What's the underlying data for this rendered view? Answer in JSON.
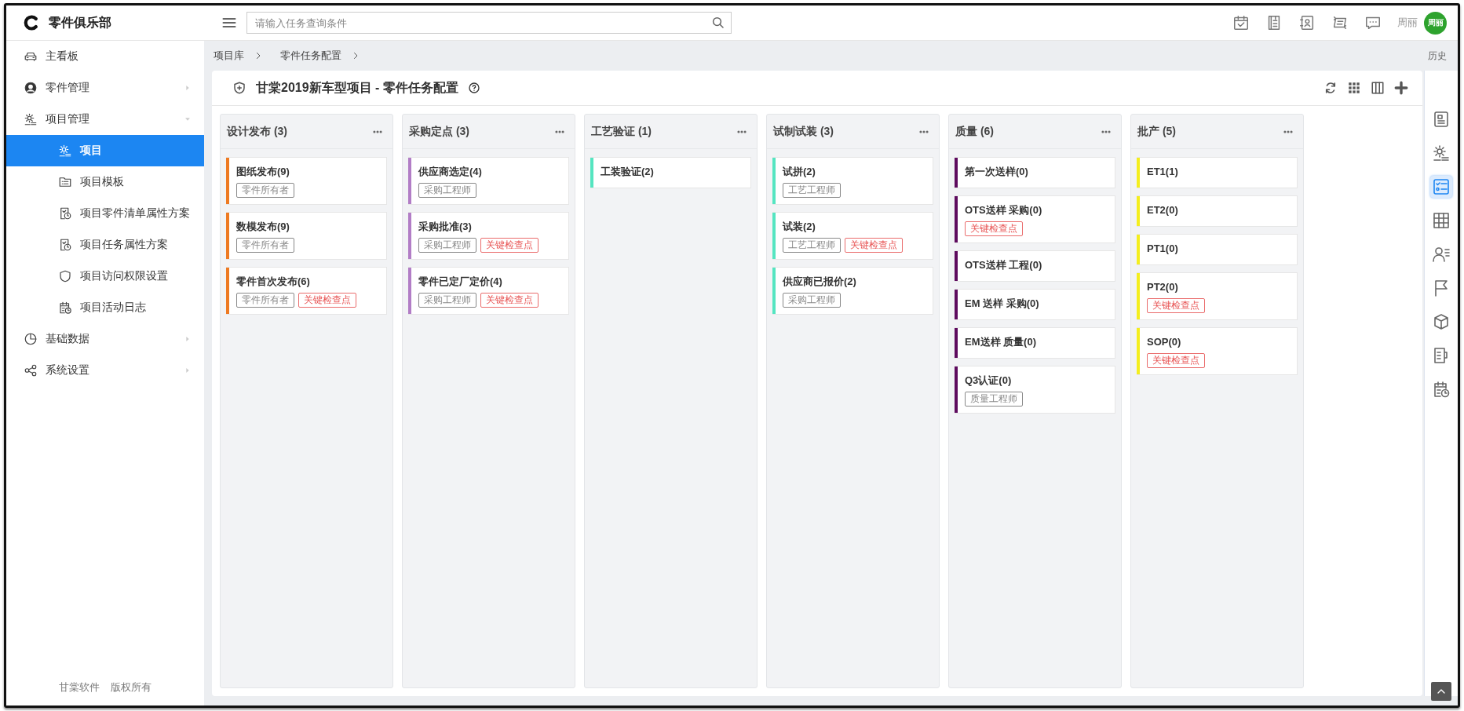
{
  "app": {
    "logo_text": "零件俱乐部"
  },
  "search": {
    "placeholder": "请输入任务查询条件"
  },
  "header_icons": [
    {
      "kind": "calendar"
    },
    {
      "kind": "notebook"
    },
    {
      "kind": "contact"
    },
    {
      "kind": "swap"
    },
    {
      "kind": "chat"
    }
  ],
  "user": {
    "name": "周丽",
    "avatar_text": "周丽"
  },
  "sidebar": {
    "items": [
      {
        "label": "主看板",
        "kind": "car",
        "selected": false
      },
      {
        "label": "零件管理",
        "kind": "person",
        "selected": false,
        "expanded": false
      },
      {
        "label": "项目管理",
        "kind": "gearlist",
        "selected": false,
        "expanded": true,
        "children": [
          {
            "label": "项目",
            "kind": "gearlist",
            "selected": true
          },
          {
            "label": "项目模板",
            "kind": "folder",
            "selected": false
          },
          {
            "label": "项目零件清单属性方案",
            "kind": "docclock",
            "selected": false
          },
          {
            "label": "项目任务属性方案",
            "kind": "docclock",
            "selected": false
          },
          {
            "label": "项目访问权限设置",
            "kind": "shield",
            "selected": false
          },
          {
            "label": "项目活动日志",
            "kind": "calclock",
            "selected": false
          }
        ]
      },
      {
        "label": "基础数据",
        "kind": "pie",
        "selected": false,
        "expanded": false
      },
      {
        "label": "系统设置",
        "kind": "share",
        "selected": false,
        "expanded": false
      }
    ],
    "footer": [
      "甘棠软件",
      "版权所有"
    ]
  },
  "breadcrumb": [
    "项目库",
    "零件任务配置"
  ],
  "history_link": "历史",
  "page_title": "甘棠2019新车型项目 - 零件任务配置",
  "toolbar_icons": [
    {
      "kind": "refresh"
    },
    {
      "kind": "dots"
    },
    {
      "kind": "columns"
    },
    {
      "kind": "plus"
    }
  ],
  "columns": [
    {
      "title": "设计发布 (3)",
      "color": "#ee7a22",
      "cards": [
        {
          "title": "图纸发布(9)",
          "tags": [
            {
              "text": "零件所有者",
              "kind": "role"
            }
          ]
        },
        {
          "title": "数模发布(9)",
          "tags": [
            {
              "text": "零件所有者",
              "kind": "role"
            }
          ]
        },
        {
          "title": "零件首次发布(6)",
          "tags": [
            {
              "text": "零件所有者",
              "kind": "role"
            },
            {
              "text": "关键检查点",
              "kind": "key"
            }
          ]
        }
      ]
    },
    {
      "title": "采购定点 (3)",
      "color": "#b27dc6",
      "cards": [
        {
          "title": "供应商选定(4)",
          "tags": [
            {
              "text": "采购工程师",
              "kind": "role"
            }
          ]
        },
        {
          "title": "采购批准(3)",
          "tags": [
            {
              "text": "采购工程师",
              "kind": "role"
            },
            {
              "text": "关键检查点",
              "kind": "key"
            }
          ]
        },
        {
          "title": "零件已定厂定价(4)",
          "tags": [
            {
              "text": "采购工程师",
              "kind": "role"
            },
            {
              "text": "关键检查点",
              "kind": "key"
            }
          ]
        }
      ]
    },
    {
      "title": "工艺验证 (1)",
      "color": "#55e5c0",
      "cards": [
        {
          "title": "工装验证(2)"
        }
      ]
    },
    {
      "title": "试制试装 (3)",
      "color": "#55e5c1",
      "cards": [
        {
          "title": "试拼(2)",
          "tags": [
            {
              "text": "工艺工程师",
              "kind": "role"
            }
          ]
        },
        {
          "title": "试装(2)",
          "tags": [
            {
              "text": "工艺工程师",
              "kind": "role"
            },
            {
              "text": "关键检查点",
              "kind": "key"
            }
          ]
        },
        {
          "title": "供应商已报价(2)",
          "tags": [
            {
              "text": "采购工程师",
              "kind": "role"
            }
          ]
        }
      ]
    },
    {
      "title": "质量 (6)",
      "color": "#5e0b5e",
      "cards": [
        {
          "title": "第一次送样(0)"
        },
        {
          "title": "OTS送样 采购(0)",
          "tags": [
            {
              "text": "关键检查点",
              "kind": "key"
            }
          ]
        },
        {
          "title": "OTS送样 工程(0)"
        },
        {
          "title": "EM 送样 采购(0)"
        },
        {
          "title": "EM送样 质量(0)"
        },
        {
          "title": "Q3认证(0)",
          "tags": [
            {
              "text": "质量工程师",
              "kind": "role"
            }
          ]
        }
      ]
    },
    {
      "title": "批产 (5)",
      "color": "#f4ee1e",
      "cards": [
        {
          "title": "ET1(1)"
        },
        {
          "title": "ET2(0)"
        },
        {
          "title": "PT1(0)"
        },
        {
          "title": "PT2(0)",
          "tags": [
            {
              "text": "关键检查点",
              "kind": "key"
            }
          ]
        },
        {
          "title": "SOP(0)",
          "tags": [
            {
              "text": "关键检查点",
              "kind": "key"
            }
          ]
        }
      ]
    }
  ],
  "rail": [
    {
      "kind": "card",
      "selected": false
    },
    {
      "kind": "gearlist",
      "selected": false
    },
    {
      "kind": "checklist",
      "selected": true
    },
    {
      "kind": "grid",
      "selected": false
    },
    {
      "kind": "personlist",
      "selected": false
    },
    {
      "kind": "flag",
      "selected": false
    },
    {
      "kind": "cube",
      "selected": false
    },
    {
      "kind": "mug",
      "selected": false
    },
    {
      "kind": "calclock",
      "selected": false
    }
  ]
}
